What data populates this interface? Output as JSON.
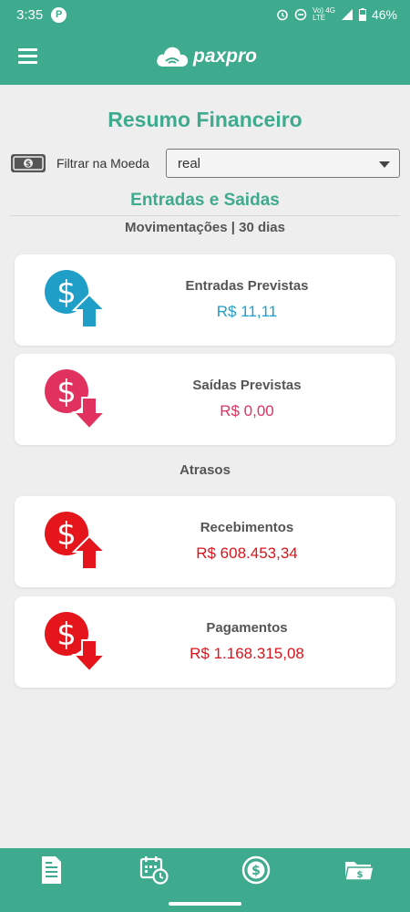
{
  "status_bar": {
    "time": "3:35",
    "app_badge": "P",
    "network_top": "Vo) 4G",
    "network_bottom": "LTE",
    "battery": "46%"
  },
  "app_bar": {
    "logo_text": "paxpro"
  },
  "page": {
    "title": "Resumo Financeiro"
  },
  "filter": {
    "label": "Filtrar na Moeda",
    "selected_value": "real"
  },
  "movements": {
    "section_title": "Entradas e Saidas",
    "period": "Movimentações | 30 dias",
    "cards": [
      {
        "label": "Entradas Previstas",
        "value": "R$  11,11",
        "color": "#1f9fc7",
        "direction": "up"
      },
      {
        "label": "Saídas Previstas",
        "value": "R$  0,00",
        "color": "#e0315f",
        "direction": "down"
      }
    ]
  },
  "delays": {
    "section_title": "Atrasos",
    "cards": [
      {
        "label": "Recebimentos",
        "value": "R$  608.453,34",
        "color": "#e5161b",
        "direction": "up"
      },
      {
        "label": "Pagamentos",
        "value": "R$  1.168.315,08",
        "color": "#e5161b",
        "direction": "down"
      }
    ]
  },
  "bottom_nav": {
    "items": [
      "document-icon",
      "calendar-clock-icon",
      "dollar-circle-icon",
      "wallet-icon"
    ]
  },
  "colors": {
    "brand": "#3eaa8e",
    "income": "#1f9fc7",
    "expense": "#e0315f",
    "overdue": "#e5161b"
  }
}
